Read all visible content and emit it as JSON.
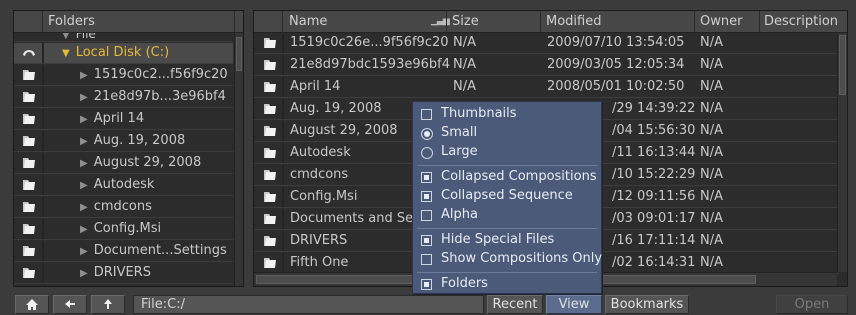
{
  "tree": {
    "header": "Folders",
    "partial_top": "File",
    "items": [
      {
        "label": "Local Disk (C:)",
        "expanded": true,
        "selected": true
      },
      {
        "label": "1519c0c2...f56f9c20"
      },
      {
        "label": "21e8d97b...3e96bf4"
      },
      {
        "label": "April 14"
      },
      {
        "label": "Aug. 19, 2008"
      },
      {
        "label": "August 29, 2008"
      },
      {
        "label": "Autodesk"
      },
      {
        "label": "cmdcons"
      },
      {
        "label": "Config.Msi"
      },
      {
        "label": "Document...Settings"
      },
      {
        "label": "DRIVERS"
      }
    ]
  },
  "files": {
    "columns": [
      "Name",
      "Size",
      "Modified",
      "Owner",
      "Description"
    ],
    "rows": [
      {
        "name": "1519c0c26e...9f56f9c20",
        "size": "N/A",
        "modified": "2009/07/10 13:54:05",
        "owner": "N/A"
      },
      {
        "name": "21e8d97bdc1593e96bf4",
        "size": "N/A",
        "modified": "2009/03/05 12:05:34",
        "owner": "N/A"
      },
      {
        "name": "April 14",
        "size": "N/A",
        "modified": "2008/05/01 10:02:50",
        "owner": "N/A"
      },
      {
        "name": "Aug. 19, 2008",
        "size": "",
        "modified": "/29 14:39:22",
        "owner": "N/A"
      },
      {
        "name": "August 29, 2008",
        "size": "",
        "modified": "/04 15:56:30",
        "owner": "N/A"
      },
      {
        "name": "Autodesk",
        "size": "",
        "modified": "/11 16:13:44",
        "owner": "N/A"
      },
      {
        "name": "cmdcons",
        "size": "",
        "modified": "/10 15:22:29",
        "owner": "N/A"
      },
      {
        "name": "Config.Msi",
        "size": "",
        "modified": "/12 09:11:56",
        "owner": "N/A"
      },
      {
        "name": "Documents and Set",
        "size": "",
        "modified": "/03 09:01:17",
        "owner": "N/A"
      },
      {
        "name": "DRIVERS",
        "size": "",
        "modified": "/16 17:11:14",
        "owner": "N/A"
      },
      {
        "name": "Fifth One",
        "size": "",
        "modified": "/02 16:14:31",
        "owner": "N/A"
      }
    ]
  },
  "view_menu": {
    "items": [
      {
        "label": "Thumbnails",
        "kind": "checkbox",
        "checked": false
      },
      {
        "label": "Small",
        "kind": "radio",
        "checked": true
      },
      {
        "label": "Large",
        "kind": "radio",
        "checked": false
      },
      {
        "label": "Collapsed Compositions",
        "kind": "checkbox",
        "checked": true
      },
      {
        "label": "Collapsed Sequence",
        "kind": "checkbox",
        "checked": true
      },
      {
        "label": "Alpha",
        "kind": "checkbox",
        "checked": false
      },
      {
        "label": "Hide Special Files",
        "kind": "checkbox",
        "checked": true
      },
      {
        "label": "Show Compositions Only",
        "kind": "checkbox",
        "checked": false
      },
      {
        "label": "Folders",
        "kind": "checkbox",
        "checked": true
      }
    ]
  },
  "toolbar": {
    "home_icon": "home-icon",
    "back_icon": "arrow-left-icon",
    "up_icon": "arrow-up-icon",
    "path": "File:C:/",
    "recent_label": "Recent",
    "view_label": "View",
    "bookmarks_label": "Bookmarks",
    "open_label": "Open"
  },
  "colors": {
    "background": "#3b3b3b",
    "selected_text": "#e7b838",
    "menu_bg": "#4a5a78",
    "active_button": "#5b6c8f"
  }
}
